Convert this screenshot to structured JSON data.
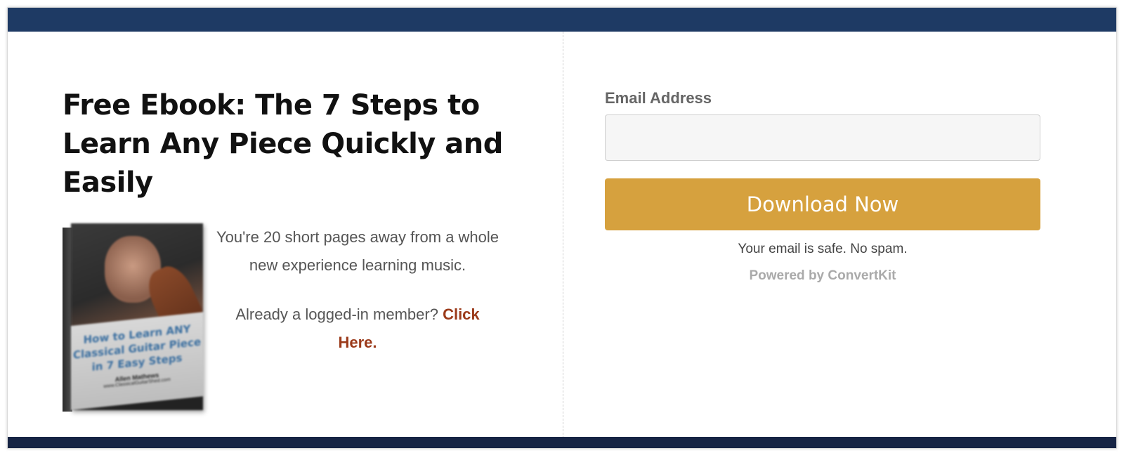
{
  "colors": {
    "top_bar": "#1e3a64",
    "bottom_bar": "#162444",
    "button": "#d6a13e",
    "link": "#9b3a1a"
  },
  "offer": {
    "headline": "Free Ebook: The 7 Steps to Learn Any Piece Quickly and Easily",
    "description": "You're 20 short pages away from a whole new experience learning music.",
    "member_prompt": "Already a logged-in member?",
    "member_link": "Click Here."
  },
  "book": {
    "title": "How to Learn ANY\nClassical Guitar Piece\nin 7 Easy Steps",
    "author": "Allen Mathews",
    "website": "www.ClassicalGuitarShed.com"
  },
  "form": {
    "email_label": "Email Address",
    "email_value": "",
    "email_placeholder": "",
    "submit_label": "Download Now",
    "privacy_note": "Your email is safe. No spam.",
    "powered_by": "Powered by ConvertKit"
  }
}
